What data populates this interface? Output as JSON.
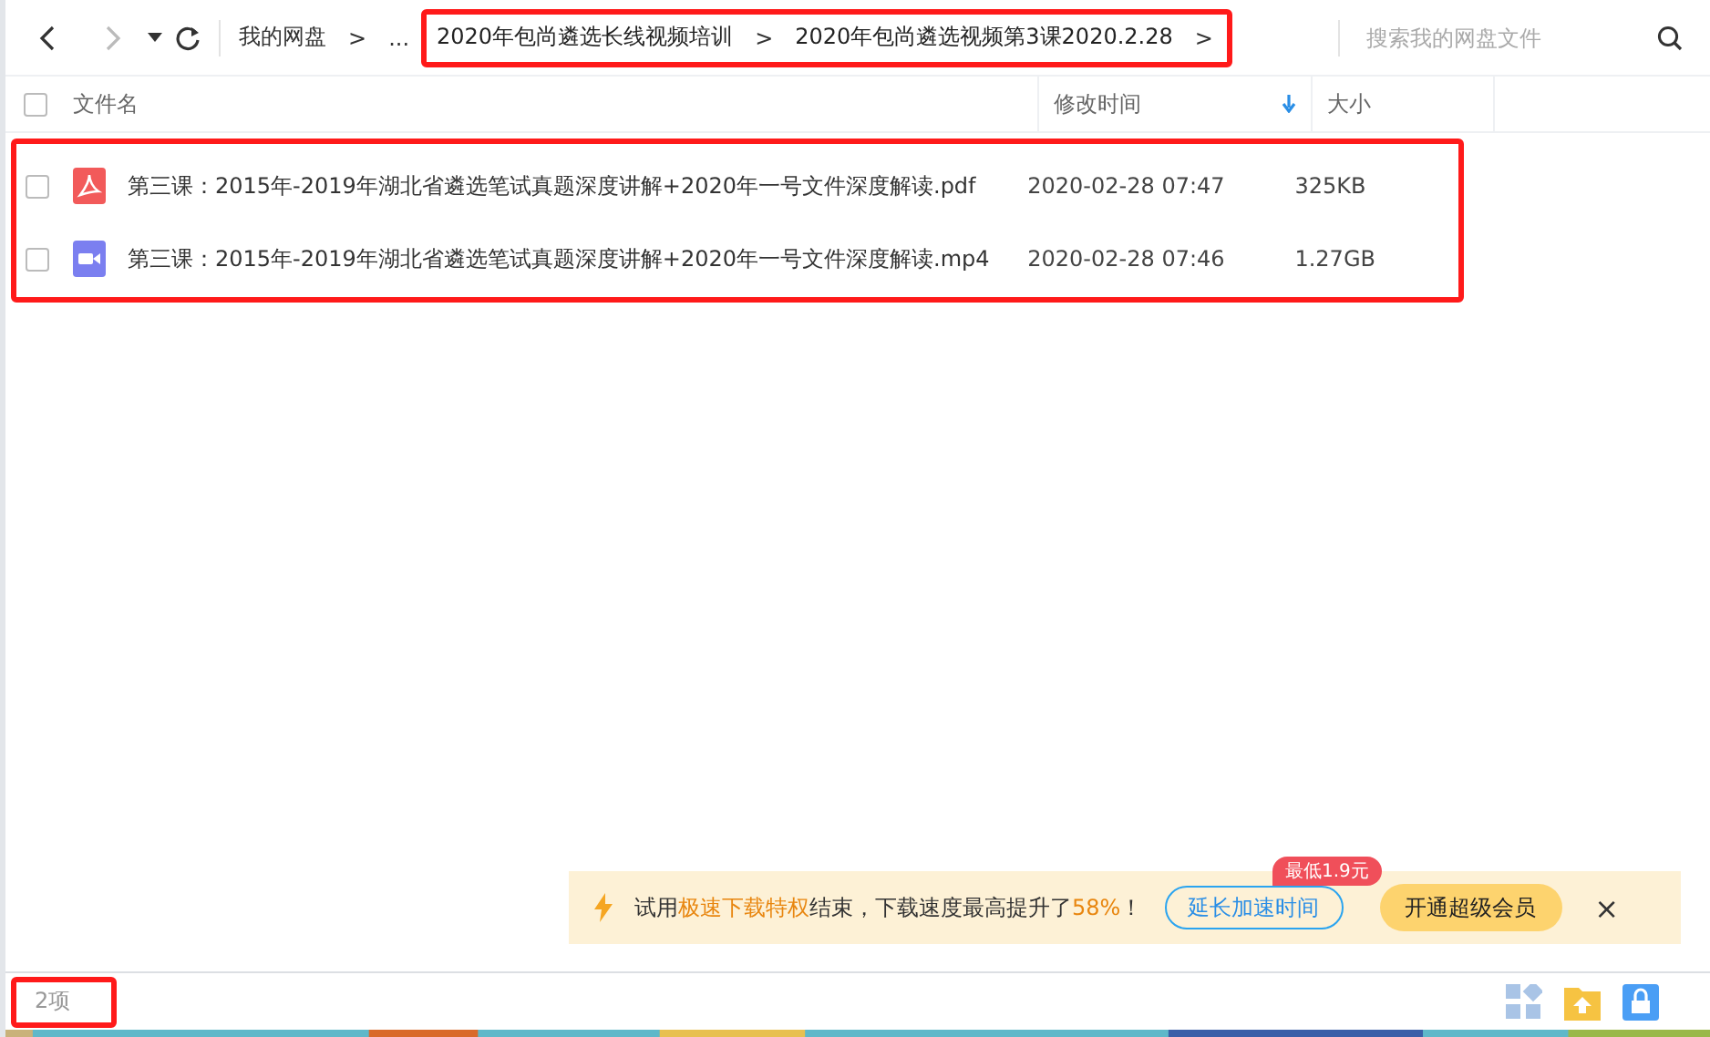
{
  "toolbar": {
    "root": "我的网盘",
    "separator": ">",
    "ellipsis": "...",
    "highlighted": true,
    "path": [
      {
        "label": "2020年包尚遴选长线视频培训"
      },
      {
        "label": "2020年包尚遴选视频第3课2020.2.28"
      }
    ],
    "search": {
      "placeholder": "搜索我的网盘文件"
    }
  },
  "table": {
    "columns": [
      {
        "label": "文件名",
        "sorted": false
      },
      {
        "label": "修改时间",
        "sorted": true
      },
      {
        "label": "大小",
        "sorted": false
      }
    ],
    "header_checked": false,
    "highlighted": true,
    "rows": [
      {
        "kind": "pdf",
        "name": "第三课：2015年-2019年湖北省遴选笔试真题深度讲解+2020年一号文件深度解读.pdf",
        "modified": "2020-02-28 07:47",
        "size": "325KB",
        "checked": false
      },
      {
        "kind": "video",
        "name": "第三课：2015年-2019年湖北省遴选笔试真题深度讲解+2020年一号文件深度解读.mp4",
        "modified": "2020-02-28 07:46",
        "size": "1.27GB",
        "checked": false
      }
    ]
  },
  "banner": {
    "message": "试用**极速下载特权**结束，下载速度最高提升了**58%**！",
    "badge": "最低1.9元",
    "extend_button": "延长加速时间",
    "vip_button": "开通超级会员",
    "close": "×"
  },
  "status_bar": {
    "count": "2项",
    "highlighted": true
  }
}
